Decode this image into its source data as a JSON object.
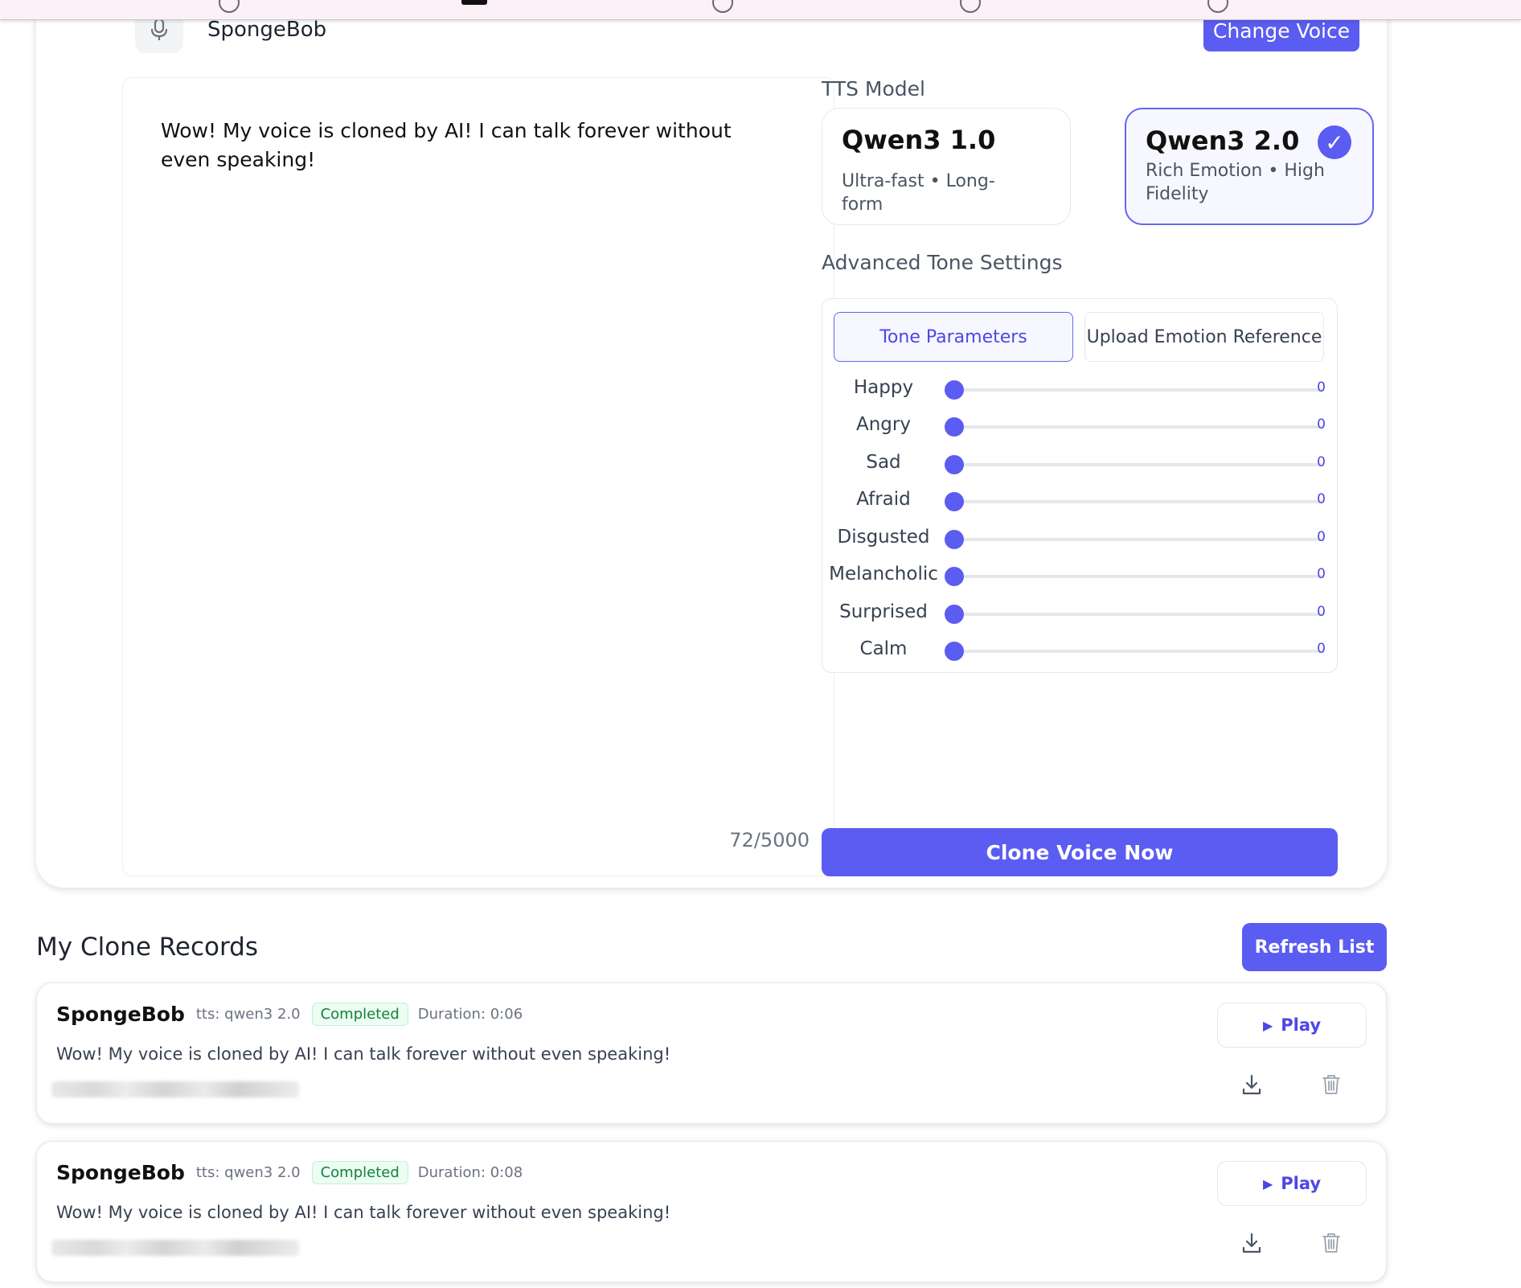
{
  "voice": {
    "name": "SpongeBob",
    "change_label": "Change Voice"
  },
  "editor": {
    "text": "Wow! My voice is cloned by AI! I can talk forever without even speaking!",
    "char_count": "72/5000"
  },
  "tts": {
    "section_label": "TTS Model",
    "models": [
      {
        "name": "Qwen3 1.0",
        "desc": "Ultra-fast • Long-form",
        "selected": false
      },
      {
        "name": "Qwen3 2.0",
        "desc": "Rich Emotion • High Fidelity",
        "selected": true
      }
    ],
    "check_glyph": "✓"
  },
  "tone": {
    "section_label": "Advanced Tone Settings",
    "tabs": [
      {
        "label": "Tone Parameters",
        "active": true
      },
      {
        "label": "Upload Emotion Reference",
        "active": false
      }
    ],
    "sliders": [
      {
        "label": "Happy",
        "value": "0"
      },
      {
        "label": "Angry",
        "value": "0"
      },
      {
        "label": "Sad",
        "value": "0"
      },
      {
        "label": "Afraid",
        "value": "0"
      },
      {
        "label": "Disgusted",
        "value": "0"
      },
      {
        "label": "Melancholic",
        "value": "0"
      },
      {
        "label": "Surprised",
        "value": "0"
      },
      {
        "label": "Calm",
        "value": "0"
      }
    ]
  },
  "clone_button": "Clone Voice Now",
  "records": {
    "title": "My Clone Records",
    "refresh_label": "Refresh List",
    "play_label": "Play",
    "items": [
      {
        "name": "SpongeBob",
        "model": "tts: qwen3 2.0",
        "status": "Completed",
        "duration": "Duration: 0:06",
        "text": "Wow! My voice is cloned by AI! I can talk forever without even speaking!"
      },
      {
        "name": "SpongeBob",
        "model": "tts: qwen3 2.0",
        "status": "Completed",
        "duration": "Duration: 0:08",
        "text": "Wow! My voice is cloned by AI! I can talk forever without even speaking!"
      }
    ]
  },
  "colors": {
    "accent": "#5b5cf2",
    "success": "#15803d"
  },
  "icons": {
    "mic": "microphone-icon",
    "check": "check-icon",
    "play": "play-icon",
    "download": "download-icon",
    "delete": "trash-icon"
  }
}
